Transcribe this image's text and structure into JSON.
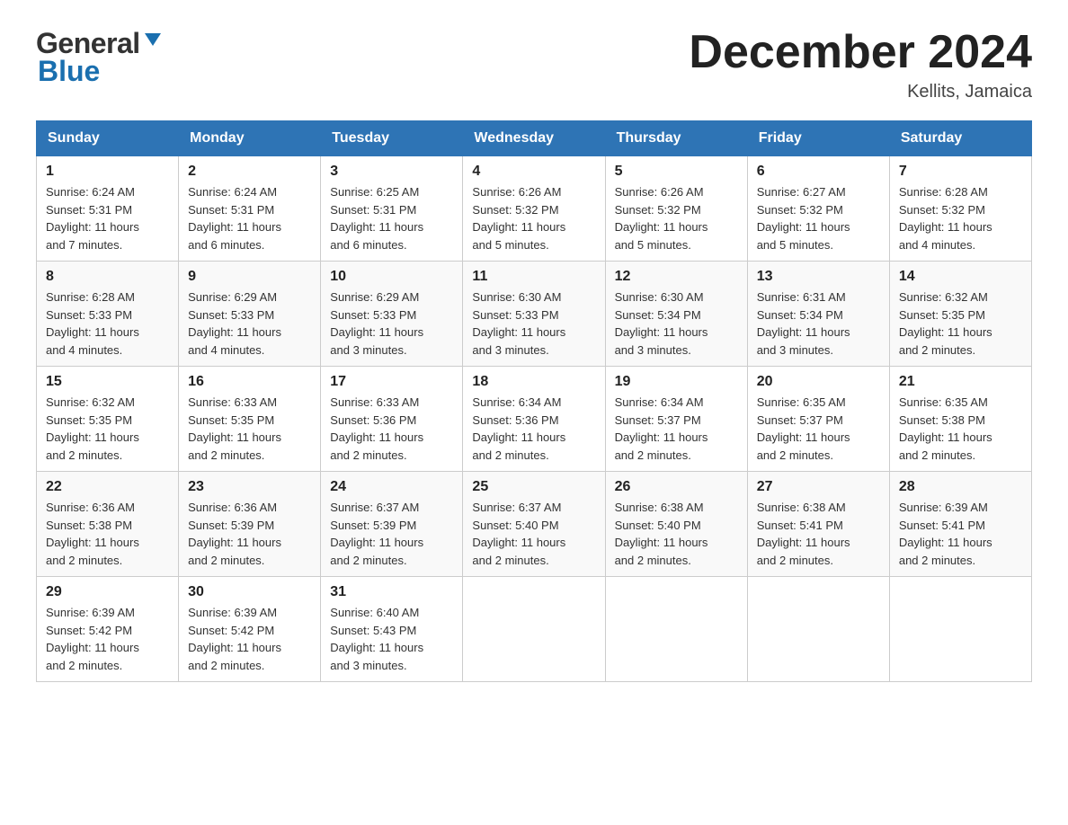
{
  "header": {
    "logo": {
      "general": "General",
      "blue": "Blue"
    },
    "title": "December 2024",
    "location": "Kellits, Jamaica"
  },
  "days_of_week": [
    "Sunday",
    "Monday",
    "Tuesday",
    "Wednesday",
    "Thursday",
    "Friday",
    "Saturday"
  ],
  "weeks": [
    [
      {
        "day": "1",
        "sunrise": "6:24 AM",
        "sunset": "5:31 PM",
        "daylight": "11 hours and 7 minutes."
      },
      {
        "day": "2",
        "sunrise": "6:24 AM",
        "sunset": "5:31 PM",
        "daylight": "11 hours and 6 minutes."
      },
      {
        "day": "3",
        "sunrise": "6:25 AM",
        "sunset": "5:31 PM",
        "daylight": "11 hours and 6 minutes."
      },
      {
        "day": "4",
        "sunrise": "6:26 AM",
        "sunset": "5:32 PM",
        "daylight": "11 hours and 5 minutes."
      },
      {
        "day": "5",
        "sunrise": "6:26 AM",
        "sunset": "5:32 PM",
        "daylight": "11 hours and 5 minutes."
      },
      {
        "day": "6",
        "sunrise": "6:27 AM",
        "sunset": "5:32 PM",
        "daylight": "11 hours and 5 minutes."
      },
      {
        "day": "7",
        "sunrise": "6:28 AM",
        "sunset": "5:32 PM",
        "daylight": "11 hours and 4 minutes."
      }
    ],
    [
      {
        "day": "8",
        "sunrise": "6:28 AM",
        "sunset": "5:33 PM",
        "daylight": "11 hours and 4 minutes."
      },
      {
        "day": "9",
        "sunrise": "6:29 AM",
        "sunset": "5:33 PM",
        "daylight": "11 hours and 4 minutes."
      },
      {
        "day": "10",
        "sunrise": "6:29 AM",
        "sunset": "5:33 PM",
        "daylight": "11 hours and 3 minutes."
      },
      {
        "day": "11",
        "sunrise": "6:30 AM",
        "sunset": "5:33 PM",
        "daylight": "11 hours and 3 minutes."
      },
      {
        "day": "12",
        "sunrise": "6:30 AM",
        "sunset": "5:34 PM",
        "daylight": "11 hours and 3 minutes."
      },
      {
        "day": "13",
        "sunrise": "6:31 AM",
        "sunset": "5:34 PM",
        "daylight": "11 hours and 3 minutes."
      },
      {
        "day": "14",
        "sunrise": "6:32 AM",
        "sunset": "5:35 PM",
        "daylight": "11 hours and 2 minutes."
      }
    ],
    [
      {
        "day": "15",
        "sunrise": "6:32 AM",
        "sunset": "5:35 PM",
        "daylight": "11 hours and 2 minutes."
      },
      {
        "day": "16",
        "sunrise": "6:33 AM",
        "sunset": "5:35 PM",
        "daylight": "11 hours and 2 minutes."
      },
      {
        "day": "17",
        "sunrise": "6:33 AM",
        "sunset": "5:36 PM",
        "daylight": "11 hours and 2 minutes."
      },
      {
        "day": "18",
        "sunrise": "6:34 AM",
        "sunset": "5:36 PM",
        "daylight": "11 hours and 2 minutes."
      },
      {
        "day": "19",
        "sunrise": "6:34 AM",
        "sunset": "5:37 PM",
        "daylight": "11 hours and 2 minutes."
      },
      {
        "day": "20",
        "sunrise": "6:35 AM",
        "sunset": "5:37 PM",
        "daylight": "11 hours and 2 minutes."
      },
      {
        "day": "21",
        "sunrise": "6:35 AM",
        "sunset": "5:38 PM",
        "daylight": "11 hours and 2 minutes."
      }
    ],
    [
      {
        "day": "22",
        "sunrise": "6:36 AM",
        "sunset": "5:38 PM",
        "daylight": "11 hours and 2 minutes."
      },
      {
        "day": "23",
        "sunrise": "6:36 AM",
        "sunset": "5:39 PM",
        "daylight": "11 hours and 2 minutes."
      },
      {
        "day": "24",
        "sunrise": "6:37 AM",
        "sunset": "5:39 PM",
        "daylight": "11 hours and 2 minutes."
      },
      {
        "day": "25",
        "sunrise": "6:37 AM",
        "sunset": "5:40 PM",
        "daylight": "11 hours and 2 minutes."
      },
      {
        "day": "26",
        "sunrise": "6:38 AM",
        "sunset": "5:40 PM",
        "daylight": "11 hours and 2 minutes."
      },
      {
        "day": "27",
        "sunrise": "6:38 AM",
        "sunset": "5:41 PM",
        "daylight": "11 hours and 2 minutes."
      },
      {
        "day": "28",
        "sunrise": "6:39 AM",
        "sunset": "5:41 PM",
        "daylight": "11 hours and 2 minutes."
      }
    ],
    [
      {
        "day": "29",
        "sunrise": "6:39 AM",
        "sunset": "5:42 PM",
        "daylight": "11 hours and 2 minutes."
      },
      {
        "day": "30",
        "sunrise": "6:39 AM",
        "sunset": "5:42 PM",
        "daylight": "11 hours and 2 minutes."
      },
      {
        "day": "31",
        "sunrise": "6:40 AM",
        "sunset": "5:43 PM",
        "daylight": "11 hours and 3 minutes."
      },
      null,
      null,
      null,
      null
    ]
  ],
  "labels": {
    "sunrise": "Sunrise:",
    "sunset": "Sunset:",
    "daylight": "Daylight:"
  }
}
